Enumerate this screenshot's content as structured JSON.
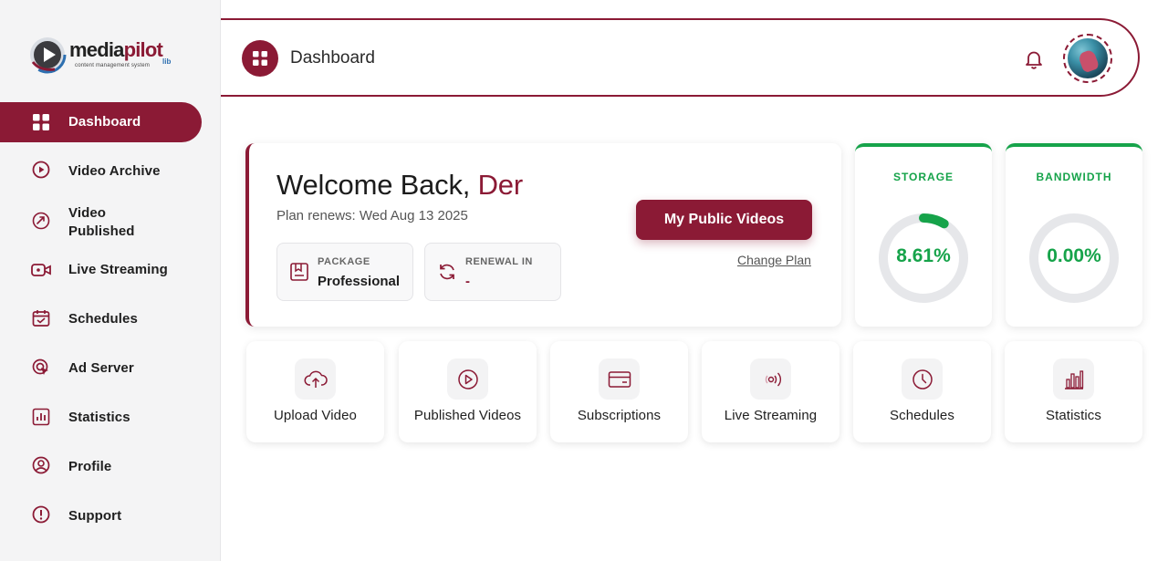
{
  "brand": {
    "name_part1": "media",
    "name_part2": "pilot",
    "tagline": "content management system",
    "suffix": "lib",
    "accent_color": "#8b1a35",
    "success_color": "#16a34a"
  },
  "sidebar": {
    "items": [
      {
        "label": "Dashboard",
        "icon": "grid-icon",
        "active": true
      },
      {
        "label": "Video Archive",
        "icon": "play-circle-icon",
        "active": false
      },
      {
        "label": "Video\nPublished",
        "icon": "rocket-icon",
        "active": false
      },
      {
        "label": "Live Streaming",
        "icon": "video-camera-icon",
        "active": false
      },
      {
        "label": "Schedules",
        "icon": "calendar-icon",
        "active": false
      },
      {
        "label": "Ad Server",
        "icon": "target-cursor-icon",
        "active": false
      },
      {
        "label": "Statistics",
        "icon": "bar-chart-icon",
        "active": false
      },
      {
        "label": "Profile",
        "icon": "user-circle-icon",
        "active": false
      },
      {
        "label": "Support",
        "icon": "info-circle-icon",
        "active": false
      }
    ]
  },
  "header": {
    "title": "Dashboard",
    "bell_icon": "bell-icon",
    "avatar_icon": "user-avatar"
  },
  "welcome": {
    "greeting": "Welcome Back, ",
    "user_name": "Der",
    "plan_renews": "Plan renews: Wed Aug 13 2025",
    "package_label": "PACKAGE",
    "package_value": "Professional",
    "renewal_label": "RENEWAL IN",
    "renewal_value": "-",
    "public_videos_button": "My Public Videos",
    "change_plan_link": "Change Plan"
  },
  "stats": {
    "storage": {
      "label": "STORAGE",
      "value_text": "8.61%",
      "percent": 8.61
    },
    "bandwidth": {
      "label": "BANDWIDTH",
      "value_text": "0.00%",
      "percent": 0.0
    }
  },
  "tiles": [
    {
      "label": "Upload Video",
      "icon": "cloud-upload-icon"
    },
    {
      "label": "Published Videos",
      "icon": "play-circle-icon"
    },
    {
      "label": "Subscriptions",
      "icon": "credit-card-icon"
    },
    {
      "label": "Live Streaming",
      "icon": "broadcast-icon"
    },
    {
      "label": "Schedules",
      "icon": "clock-icon"
    },
    {
      "label": "Statistics",
      "icon": "bar-chart-icon"
    }
  ]
}
